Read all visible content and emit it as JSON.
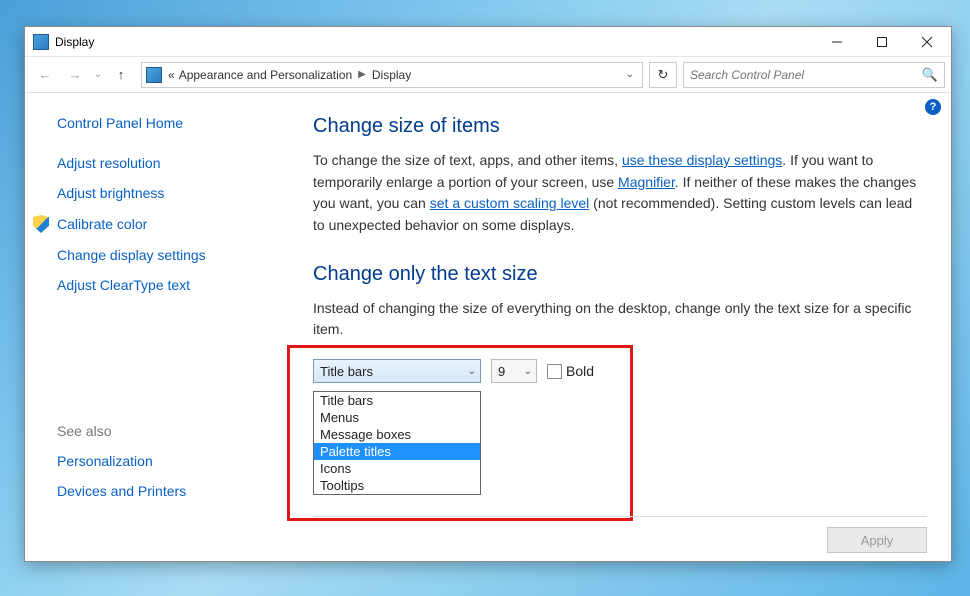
{
  "titlebar": {
    "title": "Display"
  },
  "nav": {
    "crumb_prefix": "«",
    "crumb1": "Appearance and Personalization",
    "crumb2": "Display",
    "search_placeholder": "Search Control Panel"
  },
  "sidebar": {
    "home": "Control Panel Home",
    "items": [
      "Adjust resolution",
      "Adjust brightness",
      "Calibrate color",
      "Change display settings",
      "Adjust ClearType text"
    ],
    "see_also_label": "See also",
    "see_also": [
      "Personalization",
      "Devices and Printers"
    ]
  },
  "main": {
    "h1": "Change size of items",
    "p1_a": "To change the size of text, apps, and other items, ",
    "p1_link1": "use these display settings",
    "p1_b": ".  If you want to temporarily enlarge a portion of your screen, use ",
    "p1_link2": "Magnifier",
    "p1_c": ".  If neither of these makes the changes you want, you can ",
    "p1_link3": "set a custom scaling level",
    "p1_d": " (not recommended).  Setting custom levels can lead to unexpected behavior on some displays.",
    "h2": "Change only the text size",
    "p2": "Instead of changing the size of everything on the desktop, change only the text size for a specific item.",
    "item_combo_value": "Title bars",
    "size_combo_value": "9",
    "bold_label": "Bold",
    "dropdown_options": [
      "Title bars",
      "Menus",
      "Message boxes",
      "Palette titles",
      "Icons",
      "Tooltips"
    ],
    "dropdown_selected_index": 3,
    "apply": "Apply"
  },
  "help_glyph": "?"
}
